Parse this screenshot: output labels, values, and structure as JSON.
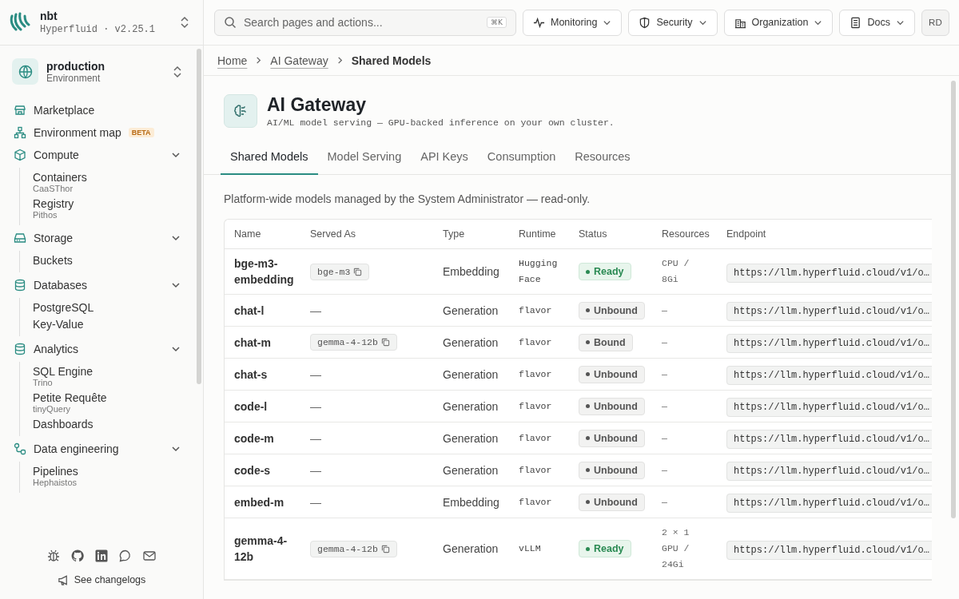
{
  "sidebar": {
    "brand": {
      "name": "nbt",
      "subtitle": "Hyperfluid · v2.25.1"
    },
    "environment": {
      "name": "production",
      "label": "Environment"
    },
    "nav": [
      {
        "kind": "link",
        "label": "Marketplace"
      },
      {
        "kind": "link",
        "label": "Environment map",
        "badge": "BETA"
      },
      {
        "kind": "group",
        "label": "Compute",
        "expanded": true,
        "children": [
          {
            "label": "Containers",
            "sub": "CaaSThor"
          },
          {
            "label": "Registry",
            "sub": "Pithos"
          }
        ]
      },
      {
        "kind": "group",
        "label": "Storage",
        "expanded": true,
        "children": [
          {
            "label": "Buckets"
          }
        ]
      },
      {
        "kind": "group",
        "label": "Databases",
        "expanded": true,
        "children": [
          {
            "label": "PostgreSQL"
          },
          {
            "label": "Key-Value"
          }
        ]
      },
      {
        "kind": "group",
        "label": "Analytics",
        "expanded": true,
        "children": [
          {
            "label": "SQL Engine",
            "sub": "Trino"
          },
          {
            "label": "Petite Requête",
            "sub": "tinyQuery"
          },
          {
            "label": "Dashboards"
          }
        ]
      },
      {
        "kind": "group",
        "label": "Data engineering",
        "expanded": true,
        "children": [
          {
            "label": "Pipelines",
            "sub": "Hephaistos"
          }
        ]
      }
    ],
    "changelog": "See changelogs"
  },
  "topbar": {
    "search": {
      "placeholder": "Search pages and actions...",
      "shortcut": "⌘K"
    },
    "menus": [
      {
        "label": "Monitoring"
      },
      {
        "label": "Security"
      },
      {
        "label": "Organization"
      },
      {
        "label": "Docs"
      }
    ],
    "avatar": "RD"
  },
  "breadcrumb": [
    {
      "label": "Home",
      "link": true
    },
    {
      "label": "AI Gateway",
      "link": true
    },
    {
      "label": "Shared Models",
      "link": false
    }
  ],
  "page": {
    "title": "AI Gateway",
    "subtitle": "AI/ML model serving — GPU-backed inference on your own cluster."
  },
  "tabs": [
    {
      "label": "Shared Models",
      "selected": true
    },
    {
      "label": "Model Serving",
      "selected": false
    },
    {
      "label": "API Keys",
      "selected": false
    },
    {
      "label": "Consumption",
      "selected": false
    },
    {
      "label": "Resources",
      "selected": false
    }
  ],
  "description": "Platform-wide models managed by the System Administrator — read-only.",
  "table": {
    "columns": [
      "Name",
      "Served As",
      "Type",
      "Runtime",
      "Status",
      "Resources",
      "Endpoint"
    ],
    "rows": [
      {
        "name": "bge-m3-embedding",
        "served_as": "bge-m3",
        "type": "Embedding",
        "runtime": "Hugging Face",
        "status": {
          "label": "Ready",
          "kind": "ready"
        },
        "resources": "CPU / 8Gi",
        "endpoint": "https://llm.hyperfluid.cloud/v1/o…"
      },
      {
        "name": "chat-l",
        "served_as": "—",
        "type": "Generation",
        "runtime": "flavor",
        "status": {
          "label": "Unbound",
          "kind": "neutral"
        },
        "resources": "—",
        "endpoint": "https://llm.hyperfluid.cloud/v1/o…"
      },
      {
        "name": "chat-m",
        "served_as": "gemma-4-12b",
        "type": "Generation",
        "runtime": "flavor",
        "status": {
          "label": "Bound",
          "kind": "neutral"
        },
        "resources": "—",
        "endpoint": "https://llm.hyperfluid.cloud/v1/o…"
      },
      {
        "name": "chat-s",
        "served_as": "—",
        "type": "Generation",
        "runtime": "flavor",
        "status": {
          "label": "Unbound",
          "kind": "neutral"
        },
        "resources": "—",
        "endpoint": "https://llm.hyperfluid.cloud/v1/o…"
      },
      {
        "name": "code-l",
        "served_as": "—",
        "type": "Generation",
        "runtime": "flavor",
        "status": {
          "label": "Unbound",
          "kind": "neutral"
        },
        "resources": "—",
        "endpoint": "https://llm.hyperfluid.cloud/v1/o…"
      },
      {
        "name": "code-m",
        "served_as": "—",
        "type": "Generation",
        "runtime": "flavor",
        "status": {
          "label": "Unbound",
          "kind": "neutral"
        },
        "resources": "—",
        "endpoint": "https://llm.hyperfluid.cloud/v1/o…"
      },
      {
        "name": "code-s",
        "served_as": "—",
        "type": "Generation",
        "runtime": "flavor",
        "status": {
          "label": "Unbound",
          "kind": "neutral"
        },
        "resources": "—",
        "endpoint": "https://llm.hyperfluid.cloud/v1/o…"
      },
      {
        "name": "embed-m",
        "served_as": "—",
        "type": "Embedding",
        "runtime": "flavor",
        "status": {
          "label": "Unbound",
          "kind": "neutral"
        },
        "resources": "—",
        "endpoint": "https://llm.hyperfluid.cloud/v1/o…"
      },
      {
        "name": "gemma-4-12b",
        "served_as": "gemma-4-12b",
        "type": "Generation",
        "runtime": "vLLM",
        "status": {
          "label": "Ready",
          "kind": "ready"
        },
        "resources": "2 × 1 GPU / 24Gi",
        "endpoint": "https://llm.hyperfluid.cloud/v1/o…"
      }
    ]
  }
}
